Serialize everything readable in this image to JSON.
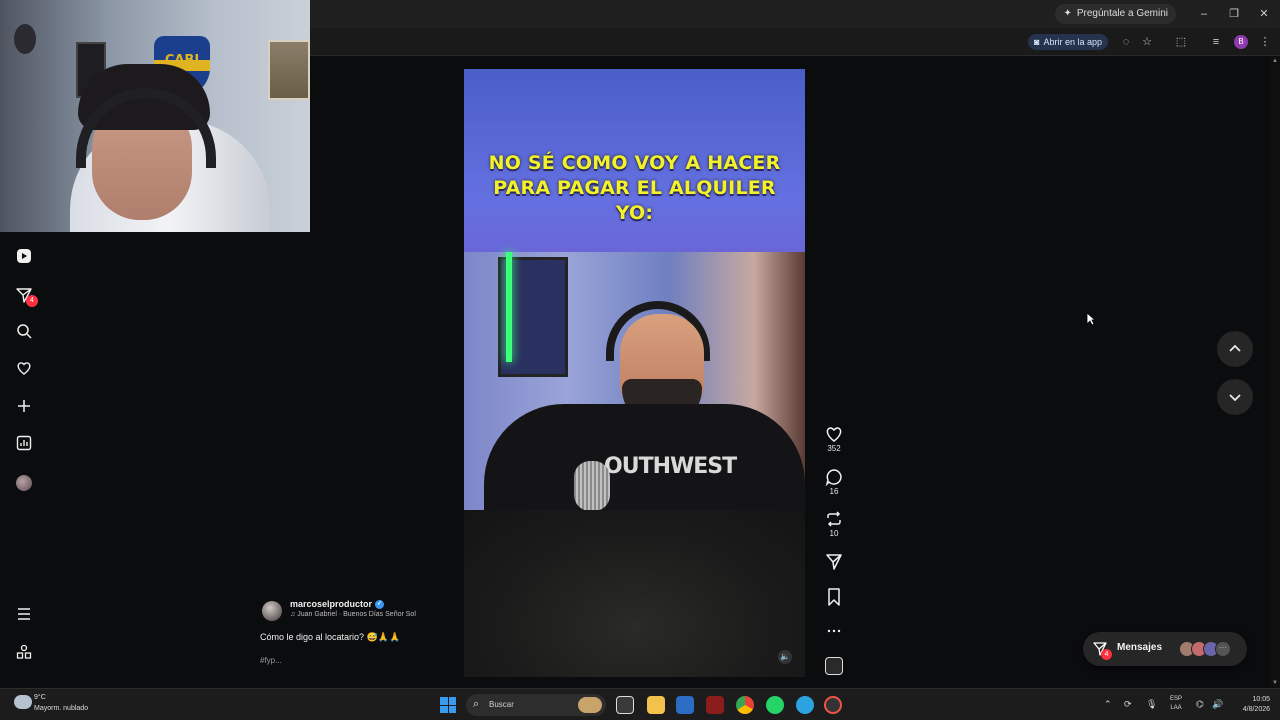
{
  "browser": {
    "gemini_label": "Pregúntale a Gemini",
    "open_in_app_label": "Abrir en la app",
    "profile_initial": "B"
  },
  "sidebar": {
    "notification_count": "4",
    "items": [
      "reels-icon",
      "direct-icon",
      "search-icon",
      "heart-icon",
      "create-icon",
      "insights-icon",
      "profile-avatar",
      "menu-icon",
      "more-apps-icon"
    ]
  },
  "reel": {
    "caption_line1": "NO SÉ COMO VOY A HACER",
    "caption_line2": "PARA PAGAR EL ALQUILER",
    "caption_line3": "YO:",
    "shirt_text": "OUTHWEST",
    "likes": "352",
    "comments": "16",
    "reposts": "10"
  },
  "post": {
    "author": "marcoselproductor",
    "audio": "♫ Juan Gabriel · Buenos Días Señor Sol",
    "caption": "Cómo le digo al locatario? 😅🙏🙏",
    "tags": "#fyp..."
  },
  "messages": {
    "label": "Mensajes",
    "count": "4"
  },
  "taskbar": {
    "temp": "9°C",
    "weather": "Mayorm. nublado",
    "search_placeholder": "Buscar",
    "lang1": "ESP",
    "lang2": "LAA",
    "time": "10:05",
    "date": "4/8/2026"
  },
  "colors": {
    "accent_blue": "#3897f0",
    "notification_red": "#ff3040",
    "caption_yellow": "#f3f22a"
  }
}
